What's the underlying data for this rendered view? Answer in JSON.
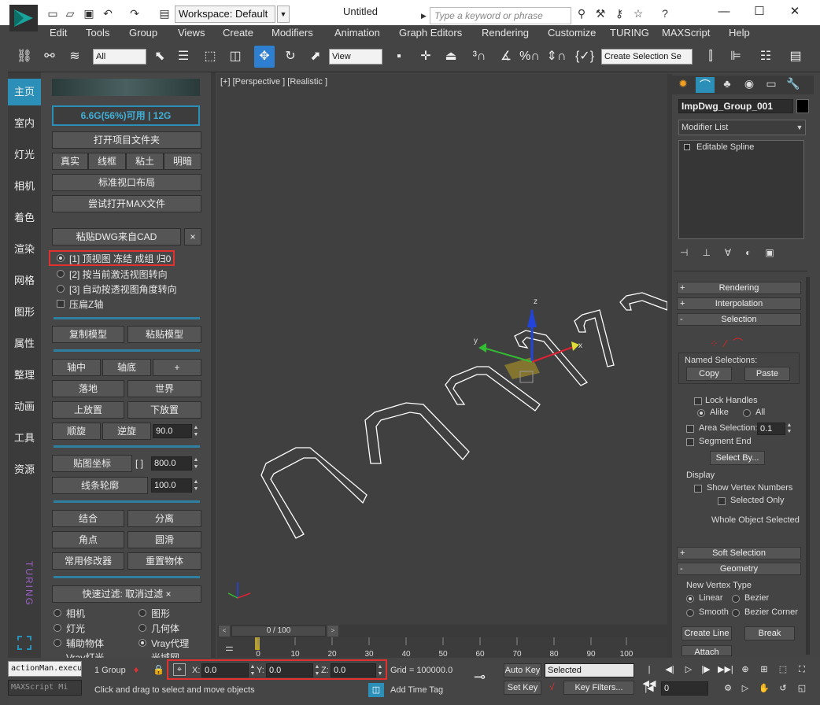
{
  "window": {
    "title": "Untitled",
    "workspace": "Workspace: Default",
    "search_placeholder": "Type a keyword or phrase",
    "minimize": "—",
    "maximize": "☐",
    "close": "✕"
  },
  "menu": [
    "Edit",
    "Tools",
    "Group",
    "Views",
    "Create",
    "Modifiers",
    "Animation",
    "Graph Editors",
    "Rendering",
    "Customize",
    "TURING",
    "MAXScript",
    "Help"
  ],
  "toolbar": {
    "selection_filter": "All",
    "ref_coord": "View",
    "named_selection_placeholder": "Create Selection Se"
  },
  "left_tabs": [
    "主页",
    "室内",
    "灯光",
    "相机",
    "着色",
    "渲染",
    "网格",
    "图形",
    "属性",
    "整理",
    "动画",
    "工具",
    "资源"
  ],
  "turing_vertical": "TURING",
  "left_panel": {
    "memory": "6.6G(56%)可用 | 12G",
    "open_project": "打开项目文件夹",
    "view_modes": [
      "真实",
      "线框",
      "粘土",
      "明暗"
    ],
    "std_layout": "标准视口布局",
    "try_open_max": "尝试打开MAX文件",
    "paste_dwg": "粘贴DWG来自CAD",
    "close_x": "×",
    "radio_options": [
      "[1] 顶视图 冻结 成组 归0",
      "[2] 按当前激活视图转向",
      "[3] 自动按透视图角度转向"
    ],
    "flatten_z": "压扁Z轴",
    "copy_model": "复制模型",
    "paste_model": "粘贴模型",
    "axis_center": "轴中",
    "axis_bottom": "轴底",
    "plus": "+",
    "drop_ground": "落地",
    "world": "世界",
    "place_up": "上放置",
    "place_down": "下放置",
    "rot_cw": "顺旋",
    "rot_ccw": "逆旋",
    "rot_value": "90.0",
    "uv_coord": "贴图坐标",
    "uv_bracket": "[ ]",
    "uv_value": "800.0",
    "line_outline": "线条轮廓",
    "outline_value": "100.0",
    "combine": "结合",
    "separate": "分离",
    "corner_point": "角点",
    "smooth": "圆滑",
    "common_mods": "常用修改器",
    "reset_obj": "重置物体",
    "quick_filter": "快速过滤:  取消过滤 ×",
    "filters": [
      "相机",
      "图形",
      "灯光",
      "几何体",
      "辅助物体",
      "Vray代理",
      "Vray灯光",
      "光域网"
    ]
  },
  "viewport": {
    "label": "[+] [Perspective ] [Realistic ]",
    "gizmo_x": "x",
    "gizmo_y": "y",
    "gizmo_z": "z"
  },
  "right_panel": {
    "object_name": "ImpDwg_Group_001",
    "modifier_list": "Modifier List",
    "stack_item": "Editable Spline",
    "rollouts": {
      "rendering": "Rendering",
      "interpolation": "Interpolation",
      "selection": "Selection",
      "soft_selection": "Soft Selection",
      "geometry": "Geometry"
    },
    "named_selections": "Named Selections:",
    "copy": "Copy",
    "paste": "Paste",
    "lock_handles": "Lock Handles",
    "alike": "Alike",
    "all": "All",
    "area_selection": "Area Selection:",
    "area_value": "0.1",
    "segment_end": "Segment End",
    "select_by": "Select By...",
    "display": "Display",
    "show_vertex_numbers": "Show Vertex Numbers",
    "selected_only": "Selected Only",
    "whole_object_selected": "Whole Object Selected",
    "new_vertex_type": "New Vertex Type",
    "linear": "Linear",
    "bezier": "Bezier",
    "smooth": "Smooth",
    "bezier_corner": "Bezier Corner",
    "create_line": "Create Line",
    "break": "Break",
    "attach": "Attach",
    "plus": "+",
    "minus": "-"
  },
  "timeline": {
    "frame": "0 / 100",
    "ticks": [
      "0",
      "10",
      "20",
      "30",
      "40",
      "50",
      "60",
      "70",
      "80",
      "90",
      "100"
    ]
  },
  "status": {
    "script_1": "actionMan.execu",
    "script_2": "MAXScript Mi",
    "group_count": "1 Group",
    "x_label": "X:",
    "x_value": "0.0",
    "y_label": "Y:",
    "y_value": "0.0",
    "z_label": "Z:",
    "z_value": "0.0",
    "grid": "Grid = 100000.0",
    "prompt": "Click and drag to select and move objects",
    "add_time_tag": "Add Time Tag",
    "auto_key": "Auto Key",
    "set_key": "Set Key",
    "selected": "Selected",
    "key_filters": "Key Filters...",
    "frame_field": "0"
  },
  "colors": {
    "accent": "#2e7fa0",
    "highlight_red": "#e03030",
    "gizmo_x": "#d23",
    "gizmo_y": "#3b3",
    "gizmo_z": "#24d"
  }
}
